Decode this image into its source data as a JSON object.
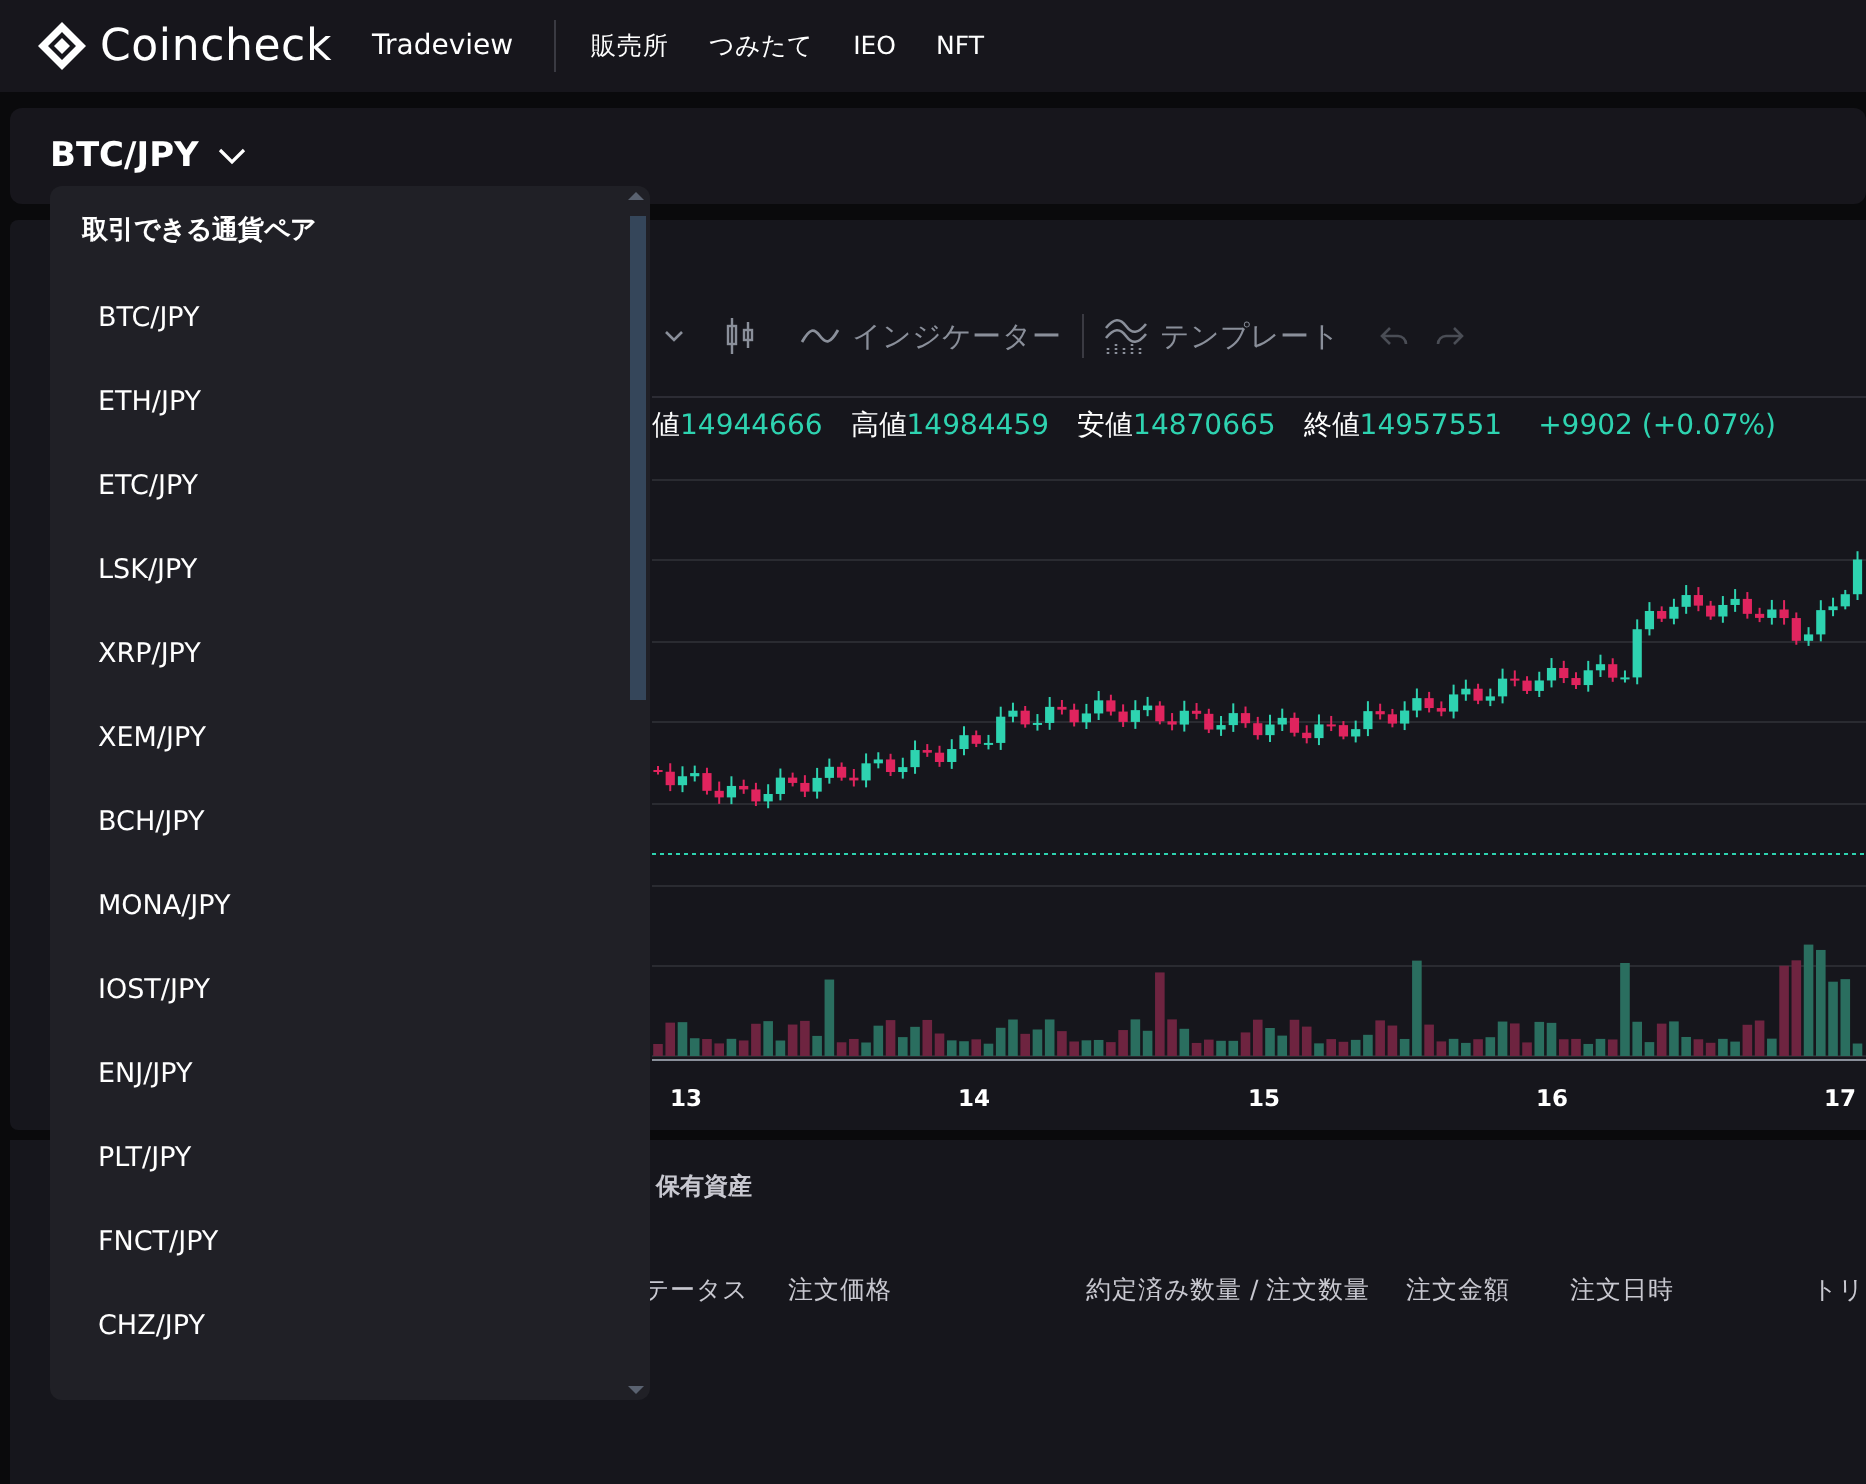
{
  "header": {
    "logo": "Coincheck",
    "app_name": "Tradeview",
    "nav": [
      "販売所",
      "つみたて",
      "IEO",
      "NFT"
    ]
  },
  "pair_selector": {
    "value": "BTC/JPY",
    "expanded": true
  },
  "pair_dropdown": {
    "title": "取引できる通貨ペア",
    "items": [
      "BTC/JPY",
      "ETH/JPY",
      "ETC/JPY",
      "LSK/JPY",
      "XRP/JPY",
      "XEM/JPY",
      "BCH/JPY",
      "MONA/JPY",
      "IOST/JPY",
      "ENJ/JPY",
      "PLT/JPY",
      "FNCT/JPY",
      "CHZ/JPY"
    ]
  },
  "chart_toolbar": {
    "indicators": "インジケーター",
    "templates": "テンプレート"
  },
  "ohlc": [
    {
      "label": "値",
      "value": "14944666"
    },
    {
      "label": "高値",
      "value": "14984459"
    },
    {
      "label": "安値",
      "value": "14870665"
    },
    {
      "label": "終値",
      "value": "14957551"
    }
  ],
  "change": "+9902 (+0.07%)",
  "x_axis_labels": [
    "13",
    "14",
    "15",
    "16",
    "17"
  ],
  "bottom_panel": {
    "tab": "保有資産",
    "columns": [
      "テータス",
      "注文価格",
      "約定済み数量 / 注文数量",
      "注文金額",
      "注文日時",
      "トリ"
    ]
  }
}
